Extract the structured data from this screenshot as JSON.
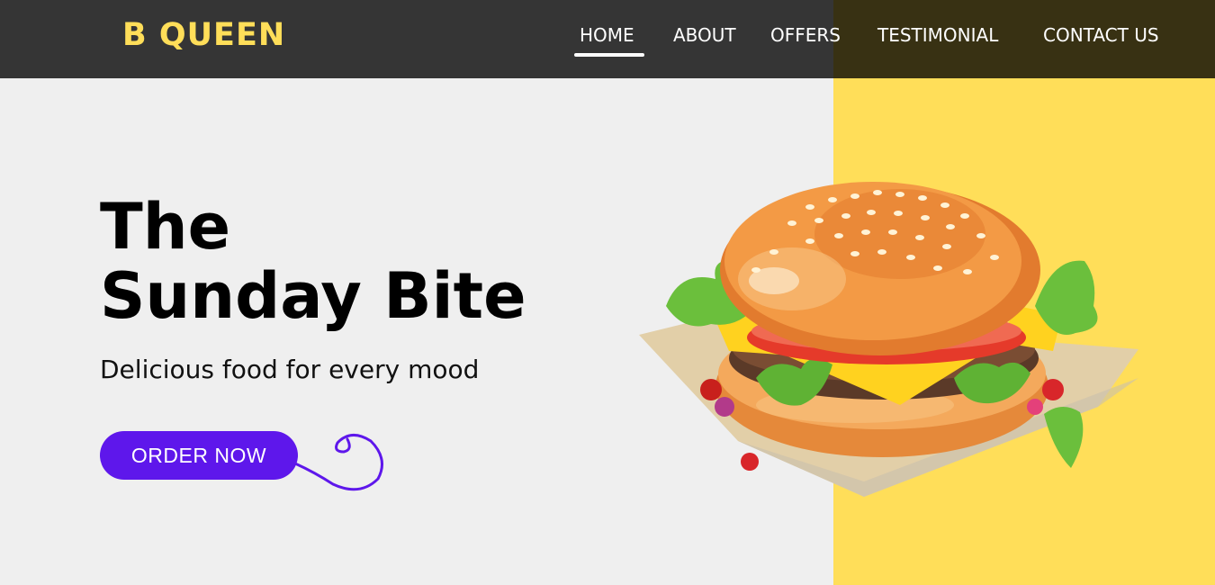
{
  "brand": {
    "logo_text": "B QUEEN"
  },
  "nav": {
    "items": [
      {
        "label": "HOME",
        "active": true
      },
      {
        "label": "ABOUT",
        "active": false
      },
      {
        "label": "OFFERS",
        "active": false
      },
      {
        "label": "TESTIMONIAL",
        "active": false
      },
      {
        "label": "CONTACT US",
        "active": false
      }
    ]
  },
  "hero": {
    "title_line1": "The",
    "title_line2": "Sunday Bite",
    "subtitle": "Delicious food for every mood",
    "cta_label": "ORDER NOW"
  },
  "colors": {
    "accent_yellow": "#ffde59",
    "button_purple": "#5e17eb",
    "navbar_dark": "#333333",
    "background": "#efefef"
  },
  "icons": {
    "hero_image": "burger-illustration",
    "cta_decoration": "curly-swirl"
  }
}
